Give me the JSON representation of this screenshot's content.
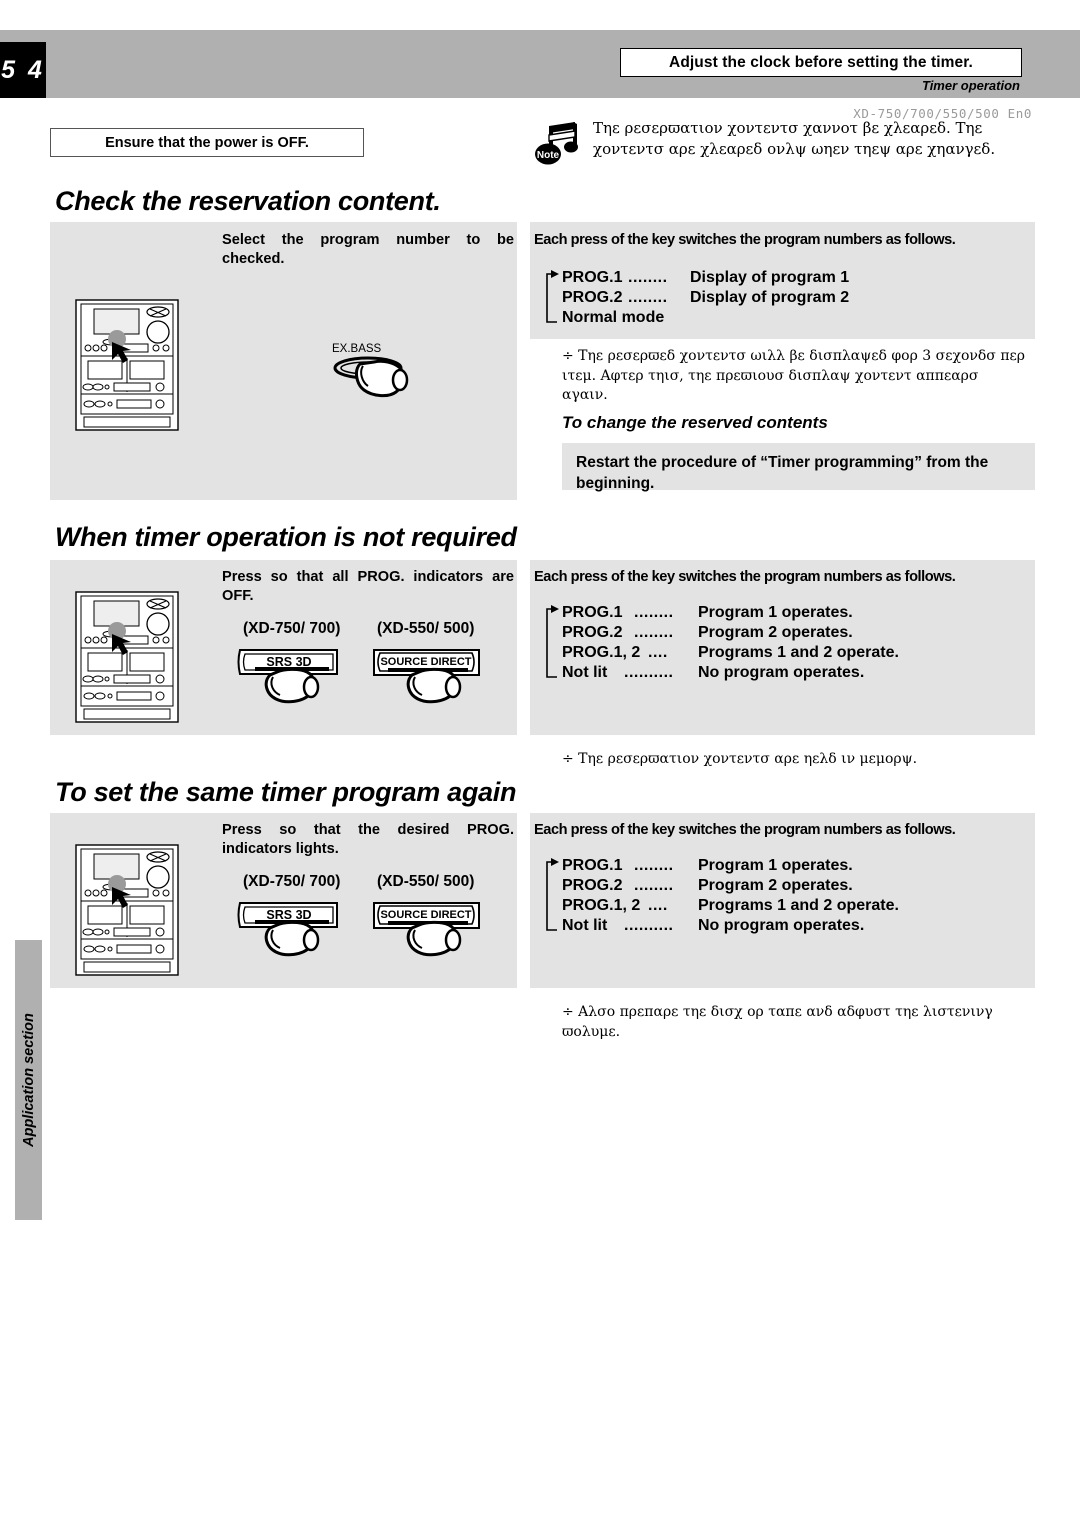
{
  "header": {
    "page_number": "5 4",
    "callout": "Adjust the clock before setting the timer.",
    "subtitle": "Timer operation",
    "model_code": "XD-750/700/550/500  En0"
  },
  "side_tab": {
    "label": "Application section"
  },
  "top_note": {
    "icon": "note-icon",
    "icon_label": "Note",
    "text": "Τηε ρεσερϖατιον χοντεντσ χαννοτ βε χλεαρεδ. Τηε χοντεντσ αρε χλεαρεδ ονλψ ωηεν τηεψ αρε χηανγεδ."
  },
  "ensure_box": {
    "label": "Ensure that the power is OFF."
  },
  "sections": [
    {
      "title": "Check the reservation content.",
      "instruction": "Select the program number to be checked.",
      "each_press": "Each press of the key switches the program numbers as follows.",
      "cycle": [
        {
          "label": "PROG.1",
          "dots": "........",
          "value": "Display of program 1"
        },
        {
          "label": "PROG.2",
          "dots": "........",
          "value": "Display of program 2"
        },
        {
          "label": "Normal mode",
          "dots": "",
          "value": ""
        }
      ],
      "button_labels": [
        "EX.BASS"
      ],
      "model_labels": [],
      "note": "÷ Τηε ρεσερϖεδ χοντεντσ ωιλλ βε δισπλαψεδ φορ 3 σεχονδσ περ ιτεμ. Αφτερ τηισ, τηε πρεϖιουσ δισπλαψ χοντεντ αππεαρσ αγαιν.",
      "subhead": "To change the reserved contents",
      "restart_box": "Restart the procedure of “Timer programming” from the beginning."
    },
    {
      "title": "When timer operation is not required",
      "instruction": "Press so that all PROG. indicators are OFF.",
      "each_press": "Each press of the key switches the program numbers as follows.",
      "cycle": [
        {
          "label": "PROG.1",
          "dots": "........",
          "value": "Program 1 operates."
        },
        {
          "label": "PROG.2",
          "dots": "........",
          "value": "Program 2 operates."
        },
        {
          "label": "PROG.1, 2",
          "dots": "....",
          "value": "Programs 1 and 2 operate."
        },
        {
          "label": "Not lit",
          "dots": "..........",
          "value": "No program operates."
        }
      ],
      "button_labels": [
        "SRS 3D",
        "SOURCE DIRECT"
      ],
      "model_labels": [
        "(XD-750/ 700)",
        "(XD-550/ 500)"
      ],
      "note": "÷ Τηε ρεσερϖατιον χοντεντσ αρε ηελδ ιν μεμορψ."
    },
    {
      "title": "To set the same timer program again",
      "instruction": "Press so that the desired PROG. indicators lights.",
      "each_press": "Each press of the key switches the program numbers as follows.",
      "cycle": [
        {
          "label": "PROG.1",
          "dots": "........",
          "value": "Program 1 operates."
        },
        {
          "label": "PROG.2",
          "dots": "........",
          "value": "Program 2 operates."
        },
        {
          "label": "PROG.1, 2",
          "dots": "....",
          "value": "Programs 1 and 2 operate."
        },
        {
          "label": "Not lit",
          "dots": "..........",
          "value": "No program operates."
        }
      ],
      "button_labels": [
        "SRS 3D",
        "SOURCE DIRECT"
      ],
      "model_labels": [
        "(XD-750/ 700)",
        "(XD-550/ 500)"
      ],
      "note": "÷ Αλσο πρεπαρε τηε δισχ ορ ταπε ανδ αδφυστ τηε λιστενινγ ϖολυμε."
    }
  ],
  "colors": {
    "header_band": "#b0b0b0",
    "panel": "#e3e3e3",
    "page_number_bg": "#000000",
    "model_code": "#9a9a9a"
  }
}
